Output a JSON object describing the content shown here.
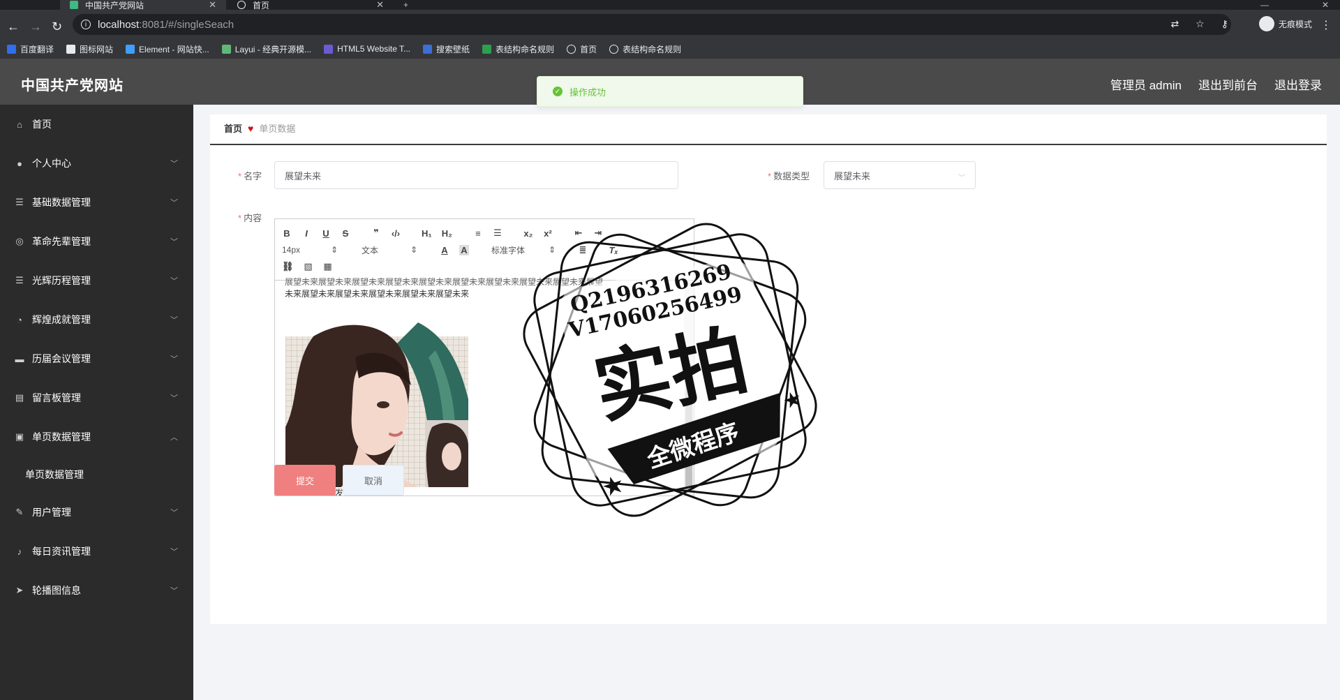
{
  "browser": {
    "tabs": [
      {
        "title": "中国共产党网站",
        "active": true
      },
      {
        "title": "首页",
        "active": false
      }
    ],
    "url_host": "localhost",
    "url_path": ":8081/#/singleSeach",
    "profile_label": "无痕模式",
    "bookmarks": [
      "百度翻译",
      "图标网站",
      "Element - 网站快...",
      "Layui - 经典开源模...",
      "HTML5 Website T...",
      "搜索壁纸",
      "表结构命名规则",
      "首页",
      "表结构命名规则"
    ]
  },
  "header": {
    "brand": "中国共产党网站",
    "admin_label": "管理员 admin",
    "to_front": "退出到前台",
    "logout": "退出登录"
  },
  "toast": {
    "message": "操作成功",
    "color": "#67c23a"
  },
  "sidebar": {
    "items": [
      {
        "label": "首页",
        "icon": "home-icon"
      },
      {
        "label": "个人中心",
        "icon": "user-icon"
      },
      {
        "label": "基础数据管理",
        "icon": "list-icon"
      },
      {
        "label": "革命先辈管理",
        "icon": "compass-icon"
      },
      {
        "label": "光辉历程管理",
        "icon": "list-icon"
      },
      {
        "label": "辉煌成就管理",
        "icon": "gauge-icon"
      },
      {
        "label": "历届会议管理",
        "icon": "briefcase-icon"
      },
      {
        "label": "留言板管理",
        "icon": "board-icon"
      },
      {
        "label": "单页数据管理",
        "icon": "clipboard-icon"
      },
      {
        "label": "用户管理",
        "icon": "edit-icon"
      },
      {
        "label": "每日资讯管理",
        "icon": "microphone-icon"
      },
      {
        "label": "轮播图信息",
        "icon": "send-icon"
      }
    ],
    "sub_item": "单页数据管理"
  },
  "breadcrumb": {
    "home": "首页",
    "current": "单页数据"
  },
  "form": {
    "name_label": "名字",
    "name_value": "展望未来",
    "type_label": "数据类型",
    "type_value": "展望未来",
    "content_label": "内容",
    "font_size": "14px",
    "text_style": "文本",
    "font_family": "标准字体",
    "content_line1": "展望未来展望未来展望未来展望未来展望未来展望未来展望未来展望未来展望未来展望",
    "content_line2": "未来展望未来展望未来展望未来展望未来展望未来",
    "caption": "大叔大婶闪电发货",
    "submit": "提交",
    "cancel": "取消"
  },
  "watermark": {
    "contact1": "Q2196316269",
    "contact2": "V17060256499",
    "big": "实拍",
    "banner": "全微程序"
  }
}
